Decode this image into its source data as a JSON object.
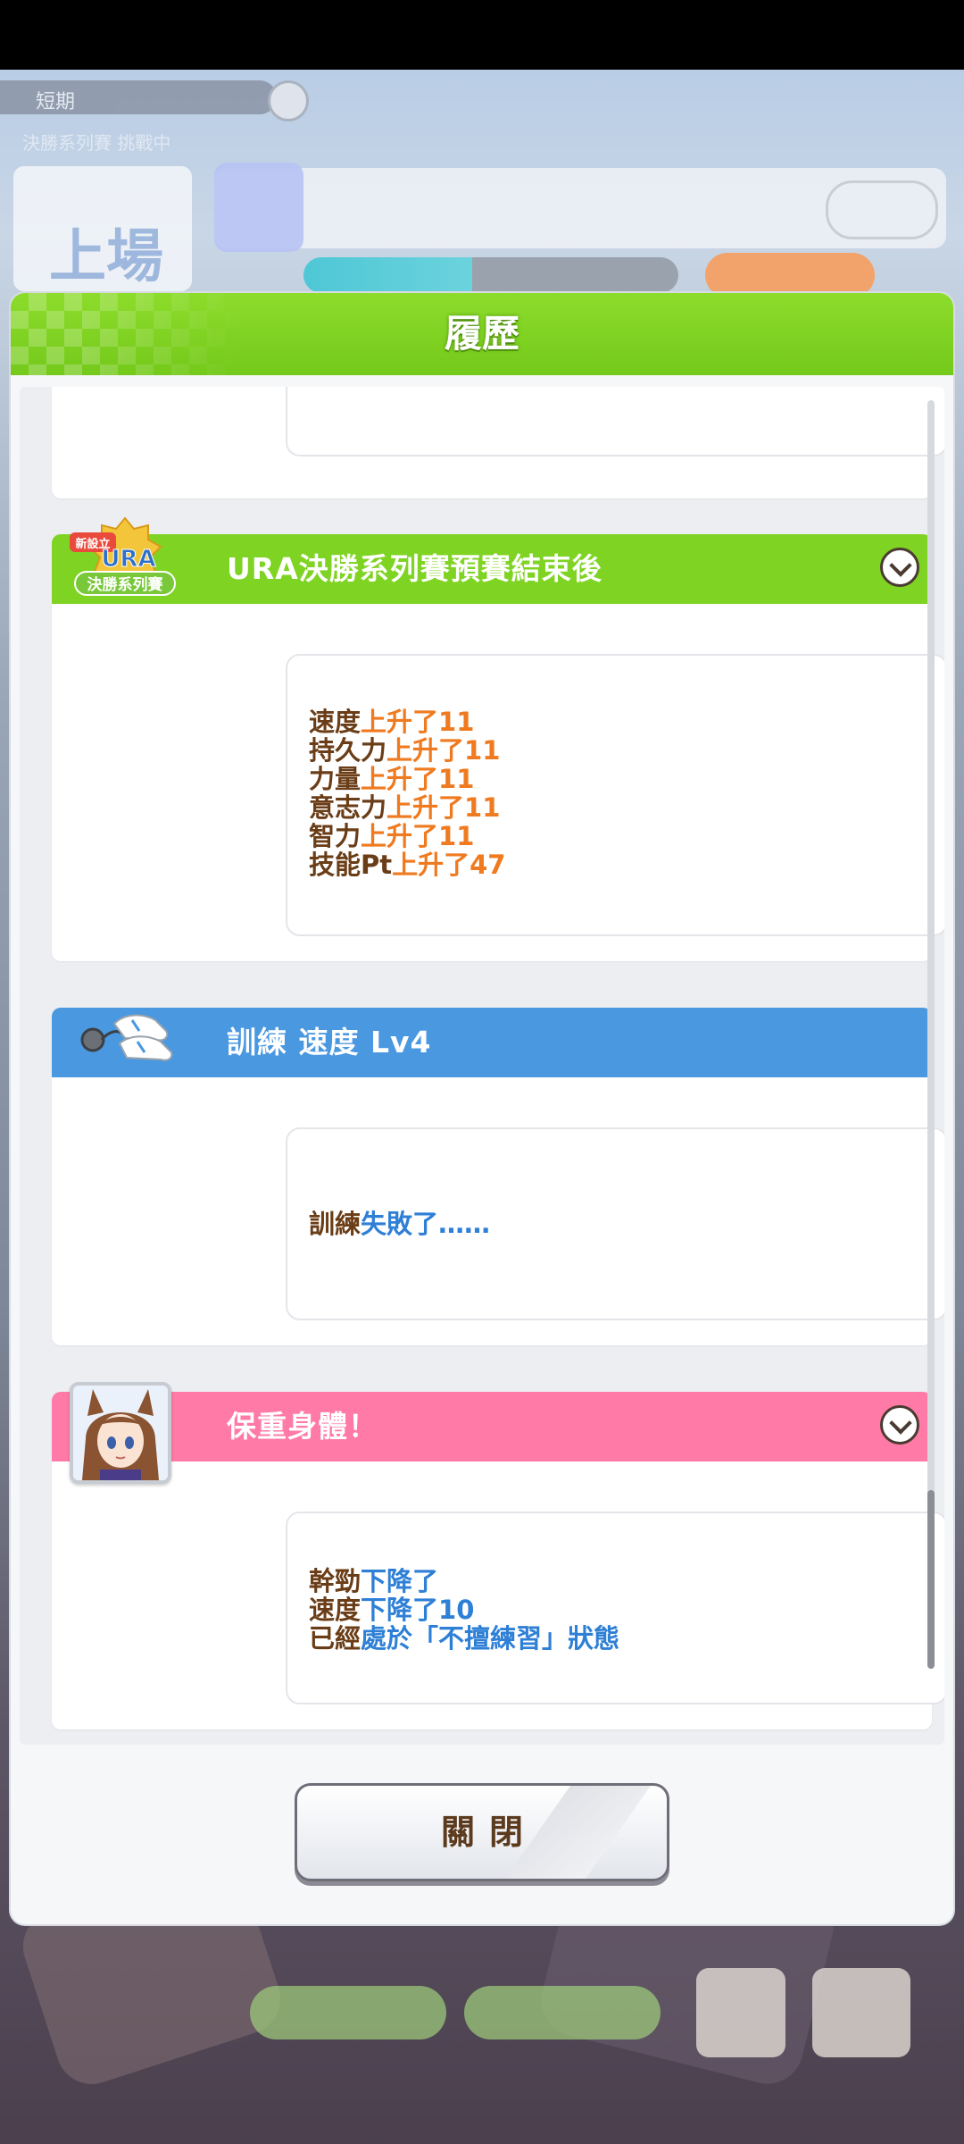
{
  "background": {
    "topbar_label": "短期",
    "subtitle": "決勝系列賽 挑戰中",
    "left_card_label": "上場"
  },
  "modal": {
    "title": "履歷",
    "close_label": "關閉"
  },
  "entries": [
    {
      "title": "URA決勝系列賽預賽結束後",
      "badge_text_top": "新設立",
      "badge_text_main": "URA",
      "badge_text_sub": "決勝系列賽",
      "lines": [
        {
          "key": "速度",
          "value": "上升了11"
        },
        {
          "key": "持久力",
          "value": "上升了11"
        },
        {
          "key": "力量",
          "value": "上升了11"
        },
        {
          "key": "意志力",
          "value": "上升了11"
        },
        {
          "key": "智力",
          "value": "上升了11"
        },
        {
          "key": "技能Pt",
          "value": "上升了47"
        }
      ]
    },
    {
      "title": "訓練 速度 Lv4",
      "lines": [
        {
          "key": "訓練",
          "value": "失敗了……"
        }
      ]
    },
    {
      "title": "保重身體！",
      "lines": [
        {
          "key": "幹勁",
          "value": "下降了"
        },
        {
          "key": "速度",
          "value": "下降了10"
        },
        {
          "key": "已經",
          "value": "處於「不擅練習」狀態"
        }
      ]
    }
  ],
  "colors": {
    "header_green": "#7fd322",
    "entry_ura": "#7fd322",
    "entry_training": "#4a98e0",
    "entry_health": "#ff7aa6",
    "text_key": "#6a3d17",
    "text_up": "#ef7a1f",
    "text_down": "#2e7fd6"
  }
}
